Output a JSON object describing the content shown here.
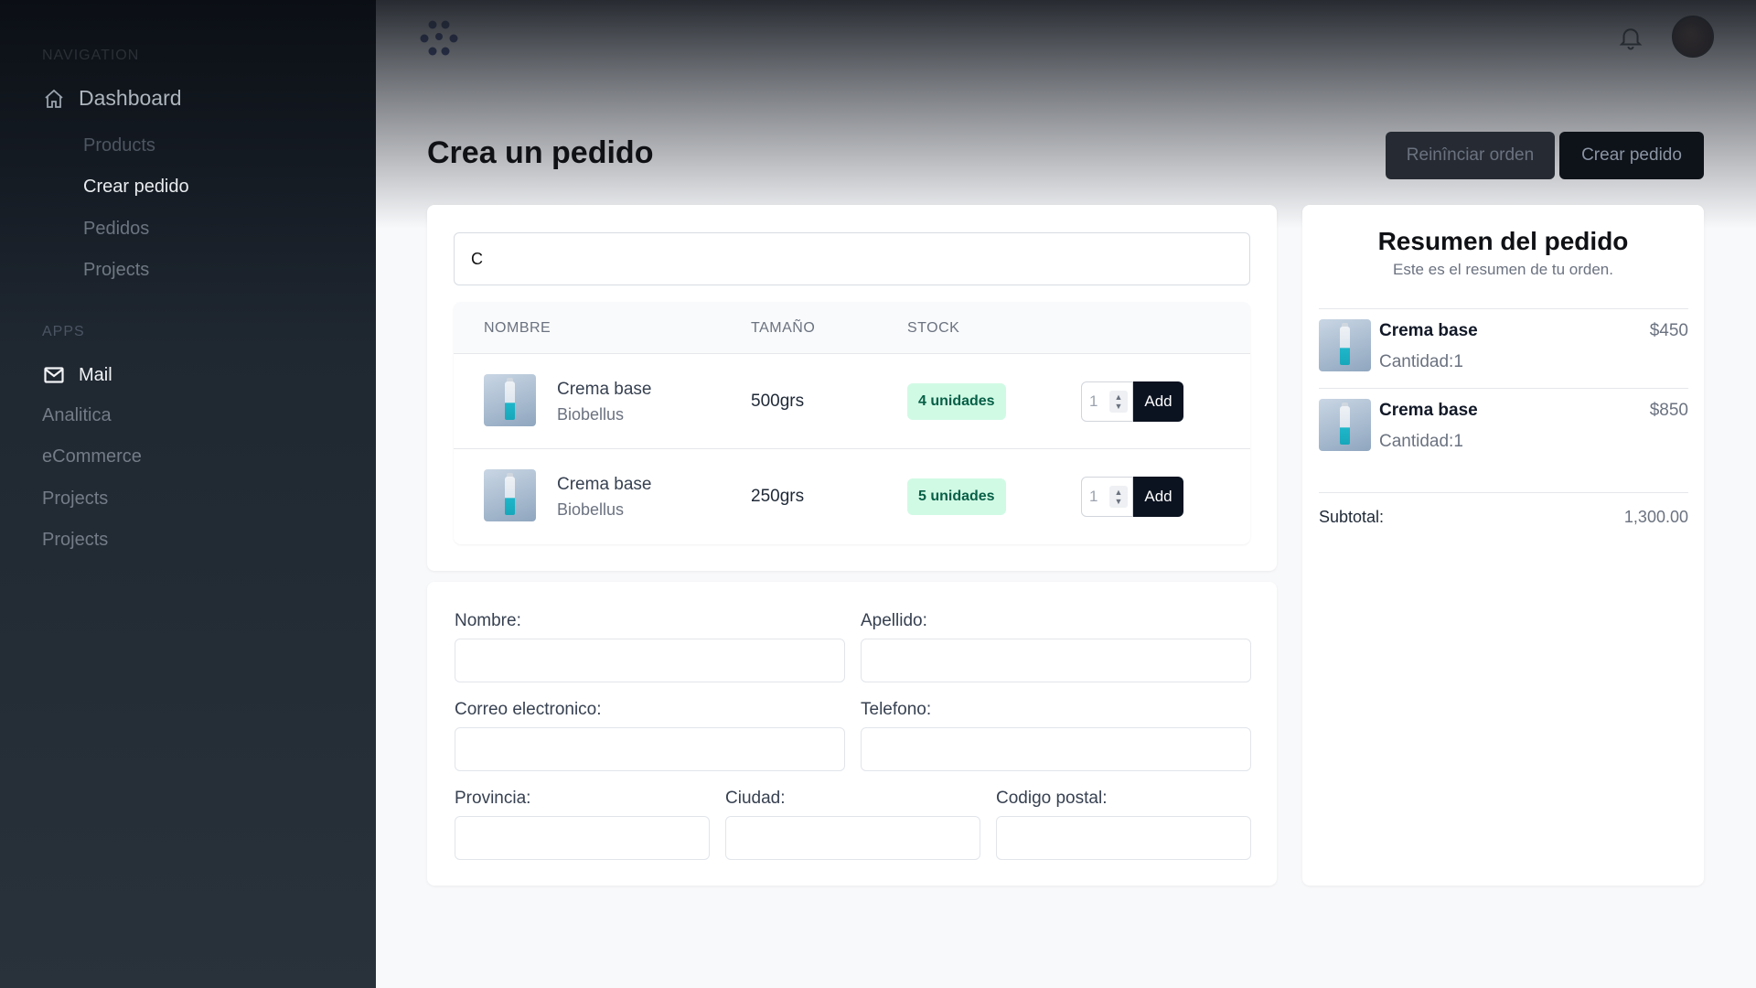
{
  "sidebar": {
    "section_main": "Navigation",
    "dashboard": "Dashboard",
    "products": "Products",
    "crear_pedido": "Crear pedido",
    "pedidos": "Pedidos",
    "projects_1": "Projects",
    "section_apps": "APPS",
    "mail": "Mail",
    "analitica": "Analitica",
    "ecommerce": "eCommerce",
    "projects_2": "Projects",
    "projects_3": "Projects"
  },
  "header": {
    "logo_icon": "flower-logo-icon",
    "bell_icon": "bell-icon",
    "avatar": "user-avatar"
  },
  "page": {
    "title": "Crea un pedido",
    "reset_button": "Reinînciar orden",
    "create_button": "Crear pedido"
  },
  "products": {
    "search_value": "C",
    "columns": [
      "NOMBRE",
      "TAMAÑO",
      "STOCK"
    ],
    "rows": [
      {
        "name": "Crema base",
        "brand": "Biobellus",
        "size": "500grs",
        "stock": "4 unidades",
        "qty": "1",
        "add": "Add"
      },
      {
        "name": "Crema base",
        "brand": "Biobellus",
        "size": "250grs",
        "stock": "5 unidades",
        "qty": "1",
        "add": "Add"
      }
    ]
  },
  "form": {
    "nombre": "Nombre:",
    "apellido": "Apellido:",
    "correo": "Correo electronico:",
    "telefono": "Telefono:",
    "provincia": "Provincia:",
    "ciudad": "Ciudad:",
    "codigo_postal": "Codigo postal:"
  },
  "summary": {
    "title": "Resumen del pedido",
    "subtitle": "Este es el resumen de tu orden.",
    "items": [
      {
        "name": "Crema base",
        "price": "$450",
        "qty": "Cantidad:1"
      },
      {
        "name": "Crema base",
        "price": "$850",
        "qty": "Cantidad:1"
      }
    ],
    "subtotal_label": "Subtotal:",
    "subtotal_value": "1,300.00"
  },
  "colors": {
    "sidebar_bg": "#29313b",
    "primary_dark": "#0b1220",
    "stock_badge_bg": "#d1fae5",
    "stock_badge_text": "#065f46"
  }
}
